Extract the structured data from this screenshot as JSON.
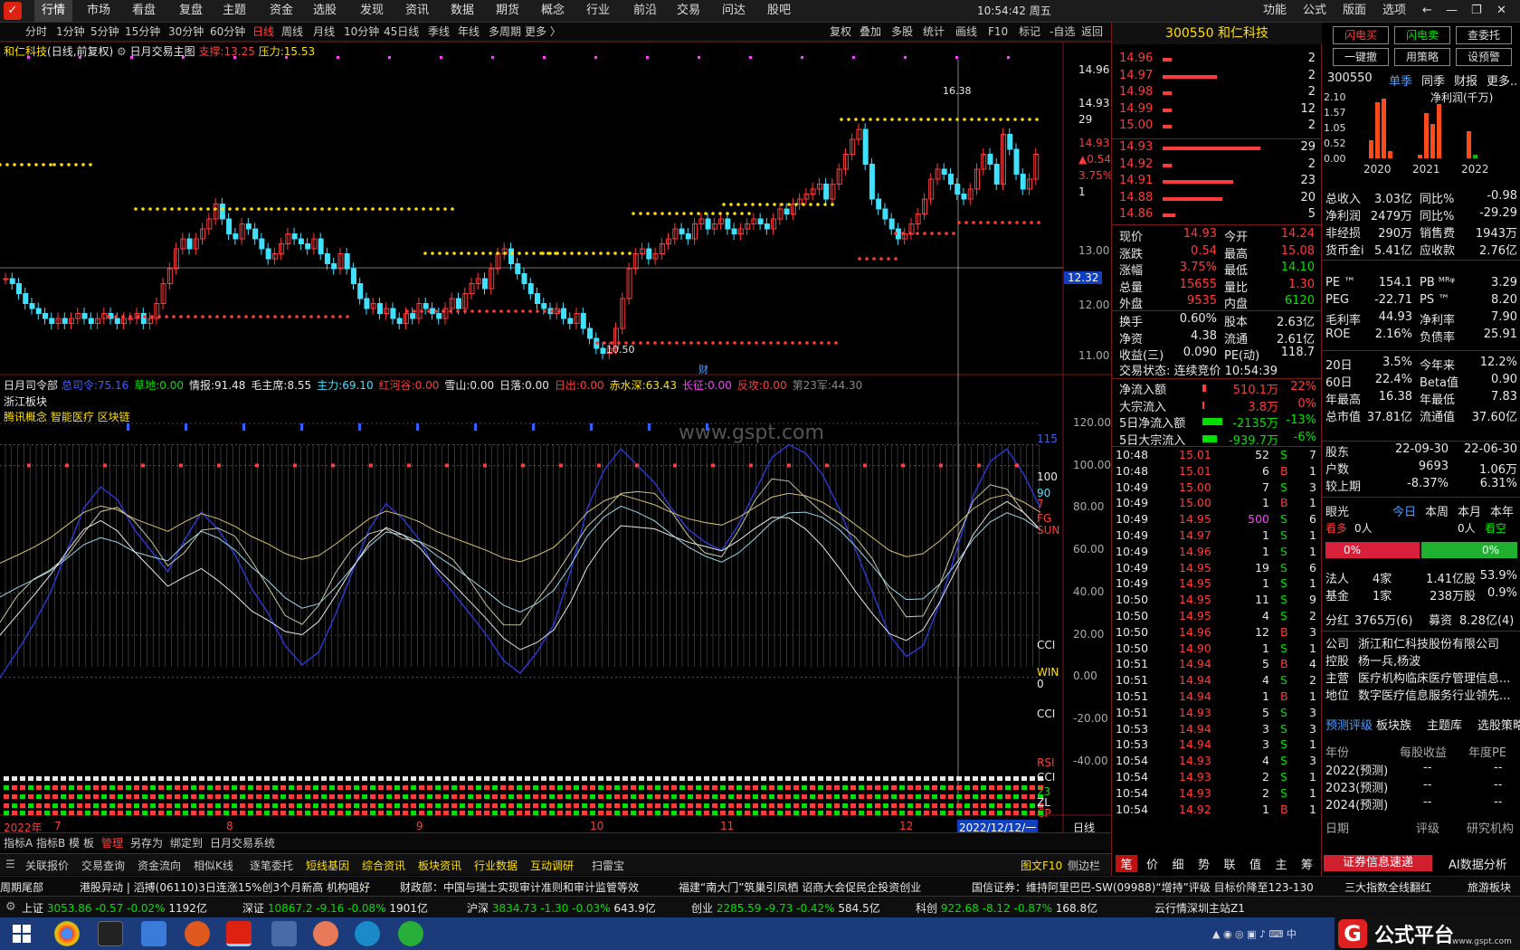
{
  "menu": {
    "items": [
      "行情",
      "市场",
      "看盘",
      "复盘",
      "主题",
      "资金",
      "选股",
      "发现",
      "资讯",
      "数据",
      "期货",
      "概念",
      "行业",
      "前沿",
      "交易",
      "问达",
      "股吧"
    ],
    "clock": "10:54:42 周五",
    "right": [
      "功能",
      "公式",
      "版面",
      "选项"
    ]
  },
  "toolbar": {
    "periods": [
      "分时",
      "1分钟",
      "5分钟",
      "15分钟",
      "30分钟",
      "60分钟",
      "日线",
      "周线",
      "月线",
      "10分钟",
      "45日线",
      "季线",
      "年线",
      "多周期",
      "更多 〉"
    ],
    "selected": "日线",
    "tools": [
      "复权",
      "叠加",
      "多股",
      "统计",
      "画线",
      "F10",
      "标记",
      "-自选",
      "返回"
    ]
  },
  "main_chart": {
    "title": "和仁科技",
    "title_suffix": "(日线,前复权)",
    "indicator": "日月交易主图",
    "support_label": "支撑:",
    "support": "13.25",
    "pressure_label": "压力:",
    "pressure": "15.53",
    "price_ticks": [
      "14.96",
      "14.93",
      "29",
      "14.93",
      "▲0.54",
      "3.75%",
      "1",
      "13.00",
      "12.32",
      "12.00",
      "11.00"
    ],
    "high_label": "16.38",
    "low_label": "10.50",
    "cai": "财"
  },
  "sub_chart": {
    "title": "日月司令部",
    "fields": [
      {
        "k": "总司令:",
        "v": "75.16",
        "c": "#4060ff"
      },
      {
        "k": "草地:",
        "v": "0.00",
        "c": "#00e000"
      },
      {
        "k": "情报:",
        "v": "91.48",
        "c": "#e8e8e8"
      },
      {
        "k": "毛主席:",
        "v": "8.55",
        "c": "#e8e8e8"
      },
      {
        "k": "主力:",
        "v": "69.10",
        "c": "#40e0ff"
      },
      {
        "k": "红河谷:",
        "v": "0.00",
        "c": "#ff3b3b"
      },
      {
        "k": "雪山:",
        "v": "0.00",
        "c": "#e8e8e8"
      },
      {
        "k": "日落:",
        "v": "0.00",
        "c": "#e8e8e8"
      },
      {
        "k": "日出:",
        "v": "0.00",
        "c": "#ff3b3b"
      },
      {
        "k": "赤水深:",
        "v": "63.43",
        "c": "#ffe000"
      },
      {
        "k": "长征:",
        "v": "0.00",
        "c": "#ff40ff"
      },
      {
        "k": "反攻:",
        "v": "0.00",
        "c": "#ff3b3b"
      },
      {
        "k": "第23军:",
        "v": "44.30",
        "c": "#888"
      }
    ],
    "sector": "浙江板块",
    "concepts": "腾讯概念 智能医疗 区块链",
    "watermark": "www.gspt.com",
    "ticks": [
      "120.00",
      "100.00",
      "80.00",
      "60.00",
      "40.00",
      "20.00",
      "0.00",
      "-20.00",
      "-40.00"
    ],
    "right_labels": [
      "115",
      "100",
      "90",
      "7",
      "FG",
      "SUN",
      "CCI",
      "WIN",
      "0",
      "CCI",
      "RSI",
      "CCI",
      "23",
      "ZL",
      "CP"
    ]
  },
  "xaxis": {
    "labels": [
      "2022年",
      "7",
      "8",
      "9",
      "10",
      "11",
      "12"
    ],
    "cursor_date": "2022/12/12/一",
    "period": "日线"
  },
  "bottom_tabs": {
    "items": [
      "指标A",
      "指标B",
      "模",
      "板",
      "管理",
      "另存为",
      "绑定到",
      "日月交易系统"
    ]
  },
  "func_tabs": {
    "items": [
      "关联报价",
      "交易查询",
      "资金流向",
      "相似K线",
      "逐笔委托",
      "短线基因",
      "综合资讯",
      "板块资讯",
      "行业数据",
      "互动调研",
      "扫雷宝"
    ],
    "right": [
      "图文F10",
      "侧边栏"
    ]
  },
  "quote": {
    "code": "300550",
    "name": "和仁科技",
    "asks": [
      {
        "p": "15.00",
        "v": "2"
      },
      {
        "p": "14.99",
        "v": "12"
      },
      {
        "p": "14.98",
        "v": "2"
      },
      {
        "p": "14.97",
        "v": "2"
      },
      {
        "p": "14.96",
        "v": "2"
      }
    ],
    "bids": [
      {
        "p": "14.93",
        "v": "29"
      },
      {
        "p": "14.92",
        "v": "2"
      },
      {
        "p": "14.91",
        "v": "23"
      },
      {
        "p": "14.88",
        "v": "20"
      },
      {
        "p": "14.86",
        "v": "5"
      }
    ],
    "stats": [
      [
        "现价",
        "14.93",
        "今开",
        "14.24"
      ],
      [
        "涨跌",
        "0.54",
        "最高",
        "15.08"
      ],
      [
        "涨幅",
        "3.75%",
        "最低",
        "14.10"
      ],
      [
        "总量",
        "15655",
        "量比",
        "1.30"
      ],
      [
        "外盘",
        "9535",
        "内盘",
        "6120"
      ]
    ],
    "stats2": [
      [
        "换手",
        "0.60%",
        "股本",
        "2.63亿"
      ],
      [
        "净资",
        "4.38",
        "流通",
        "2.61亿"
      ],
      [
        "收益(三)",
        "0.090",
        "PE(动)",
        "118.7"
      ]
    ],
    "trade_state": "交易状态: 连续竞价 10:54:39",
    "flows": [
      [
        "净流入额",
        "510.1万",
        "22%"
      ],
      [
        "大宗流入",
        "3.8万",
        "0%"
      ],
      [
        "5日净流入额",
        "-2135万",
        "-13%"
      ],
      [
        "5日大宗流入",
        "-939.7万",
        "-6%"
      ]
    ],
    "ticks": [
      [
        "10:48",
        "15.01",
        "52",
        "S",
        "7"
      ],
      [
        "10:48",
        "15.01",
        "6",
        "B",
        "1"
      ],
      [
        "10:49",
        "15.00",
        "7",
        "S",
        "3"
      ],
      [
        "10:49",
        "15.00",
        "1",
        "B",
        "1"
      ],
      [
        "10:49",
        "14.95",
        "500",
        "S",
        "6"
      ],
      [
        "10:49",
        "14.97",
        "1",
        "S",
        "1"
      ],
      [
        "10:49",
        "14.96",
        "1",
        "S",
        "1"
      ],
      [
        "10:49",
        "14.95",
        "19",
        "S",
        "6"
      ],
      [
        "10:49",
        "14.95",
        "1",
        "S",
        "1"
      ],
      [
        "10:50",
        "14.95",
        "11",
        "S",
        "9"
      ],
      [
        "10:50",
        "14.95",
        "4",
        "S",
        "2"
      ],
      [
        "10:50",
        "14.96",
        "12",
        "B",
        "3"
      ],
      [
        "10:50",
        "14.90",
        "1",
        "S",
        "1"
      ],
      [
        "10:51",
        "14.94",
        "5",
        "B",
        "4"
      ],
      [
        "10:51",
        "14.94",
        "4",
        "S",
        "2"
      ],
      [
        "10:51",
        "14.94",
        "1",
        "B",
        "1"
      ],
      [
        "10:51",
        "14.93",
        "5",
        "S",
        "3"
      ],
      [
        "10:53",
        "14.94",
        "3",
        "S",
        "3"
      ],
      [
        "10:53",
        "14.94",
        "3",
        "S",
        "1"
      ],
      [
        "10:54",
        "14.93",
        "4",
        "S",
        "3"
      ],
      [
        "10:54",
        "14.93",
        "2",
        "S",
        "1"
      ],
      [
        "10:54",
        "14.93",
        "2",
        "S",
        "1"
      ],
      [
        "10:54",
        "14.92",
        "1",
        "B",
        "1"
      ]
    ],
    "tabs": [
      "笔",
      "价",
      "细",
      "势",
      "联",
      "值",
      "主",
      "筹"
    ]
  },
  "f10": {
    "buttons": [
      "闪电买",
      "闪电卖",
      "查委托",
      "一键撤",
      "用策略",
      "设预警"
    ],
    "code": "300550",
    "tabs": [
      "单季",
      "同季",
      "财报",
      "更多.."
    ],
    "chart_title": "净利润(千万)",
    "chart_data": {
      "type": "bar",
      "y_ticks": [
        "2.10",
        "1.57",
        "1.05",
        "0.52",
        "0.00"
      ],
      "years": [
        "2020",
        "2021",
        "2022"
      ]
    },
    "fin": [
      [
        "总收入",
        "3.03亿",
        "同比%",
        "-0.98"
      ],
      [
        "净利润",
        "2479万",
        "同比%",
        "-29.29"
      ],
      [
        "非经损",
        "290万",
        "销售费",
        "1943万"
      ],
      [
        "货币金i",
        "5.41亿",
        "应收款",
        "2.76亿"
      ]
    ],
    "val": [
      [
        "PE ™",
        "154.1",
        "PB ᴹᴿᵠ",
        "3.29"
      ],
      [
        "PEG",
        "-22.71",
        "PS ™",
        "8.20"
      ],
      [
        "毛利率",
        "44.93",
        "净利率",
        "7.90"
      ],
      [
        "ROE",
        "2.16%",
        "负债率",
        "25.91"
      ]
    ],
    "perf": [
      [
        "20日",
        "3.5%",
        "今年来",
        "12.2%"
      ],
      [
        "60日",
        "22.4%",
        "Beta值",
        "0.90"
      ],
      [
        "年最高",
        "16.38",
        "年最低",
        "7.83"
      ],
      [
        "总市值",
        "37.81亿",
        "流通值",
        "37.60亿"
      ]
    ],
    "holders": [
      [
        "股东",
        "22-09-30",
        "22-06-30"
      ],
      [
        "户数",
        "9693",
        "1.06万"
      ],
      [
        "较上期",
        "-8.37%",
        "6.31%"
      ]
    ],
    "vision": {
      "title": "眼光",
      "tabs": [
        "今日",
        "本周",
        "本月",
        "本年"
      ],
      "bull": "看多",
      "bull_n": "0人",
      "bear_n": "0人",
      "bear": "看空",
      "pct_l": "0%",
      "pct_r": "0%"
    },
    "inst": [
      [
        "法人",
        "4家",
        "1.41亿股",
        "53.9%"
      ],
      [
        "基金",
        "1家",
        "238万股",
        "0.9%"
      ]
    ],
    "div": [
      "分红",
      "3765万(6)",
      "募资",
      "8.28亿(4)"
    ],
    "company": [
      [
        "公司",
        "浙江和仁科技股份有限公司"
      ],
      [
        "控股",
        "杨一兵,杨波"
      ],
      [
        "主营",
        "医疗机构临床医疗管理信息..."
      ],
      [
        "地位",
        "数字医疗信息服务行业领先..."
      ]
    ],
    "forecast_tabs": [
      "预测评级",
      "板块族",
      "主题库",
      "选股策略"
    ],
    "forecast_head": [
      "年份",
      "每股收益",
      "年度PE"
    ],
    "forecast": [
      [
        "2022(预测)",
        "--",
        "--"
      ],
      [
        "2023(预测)",
        "--",
        "--"
      ],
      [
        "2024(预测)",
        "--",
        "--"
      ]
    ],
    "rating_head": [
      "日期",
      "评级",
      "研究机构"
    ],
    "bottom_btns": [
      "证券信息速递",
      "AI数据分析"
    ]
  },
  "news": [
    "周期尾部",
    "港股异动 | 滔搏(06110)3日连涨15%创3个月新高 机构唱好",
    "财政部：中国与瑞士实现审计准则和审计监管等效",
    "福建“南大门”筑巢引凤栖  诏商大会促民企投资创业",
    "国信证券：维持阿里巴巴-SW(09988)“增持”评级 目标价降至123-130",
    "三大指数全线翻红",
    "旅游板块"
  ],
  "status": {
    "items": [
      {
        "n": "上证",
        "v": "3053.86",
        "c": "-0.57",
        "p": "-0.02%",
        "a": "1192亿"
      },
      {
        "n": "深证",
        "v": "10867.2",
        "c": "-9.16",
        "p": "-0.08%",
        "a": "1901亿"
      },
      {
        "n": "沪深",
        "v": "3834.73",
        "c": "-1.30",
        "p": "-0.03%",
        "a": "643.9亿"
      },
      {
        "n": "创业",
        "v": "2285.59",
        "c": "-9.73",
        "p": "-0.42%",
        "a": "584.5亿"
      },
      {
        "n": "科创",
        "v": "922.68",
        "c": "-8.12",
        "p": "-0.87%",
        "a": "168.8亿"
      }
    ],
    "server": "云行情深圳主站Z1"
  },
  "brand": {
    "text": "公式平台",
    "url": "www.gspt.com"
  }
}
